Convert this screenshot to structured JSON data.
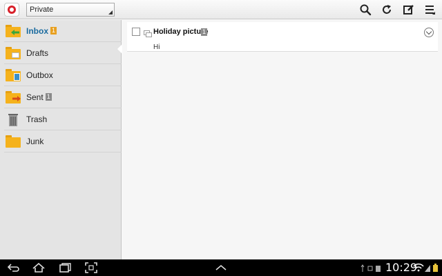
{
  "actionbar": {
    "account_selector": {
      "value": "Private"
    },
    "icons": [
      "search-icon",
      "refresh-icon",
      "compose-icon",
      "menu-icon"
    ]
  },
  "sidebar": {
    "folders": [
      {
        "label": "Inbox",
        "badge": "1",
        "icon": "inbox-folder-icon",
        "active": true
      },
      {
        "label": "Drafts",
        "badge": "",
        "icon": "drafts-folder-icon",
        "active": false
      },
      {
        "label": "Outbox",
        "badge": "",
        "icon": "outbox-folder-icon",
        "active": false
      },
      {
        "label": "Sent",
        "badge": "1",
        "icon": "sent-folder-icon",
        "active": false
      },
      {
        "label": "Trash",
        "badge": "",
        "icon": "trash-icon",
        "active": false
      },
      {
        "label": "Junk",
        "badge": "",
        "icon": "junk-folder-icon",
        "active": false
      }
    ]
  },
  "messages": [
    {
      "subject": "Holiday picture",
      "count": "1",
      "preview": "Hi"
    }
  ],
  "navbar": {
    "time": "10:29"
  },
  "colors": {
    "accent": "#1a6b9f",
    "folder": "#f5b21c",
    "badge_orange": "#e8a020",
    "badge_gray": "#8a8a8a"
  }
}
